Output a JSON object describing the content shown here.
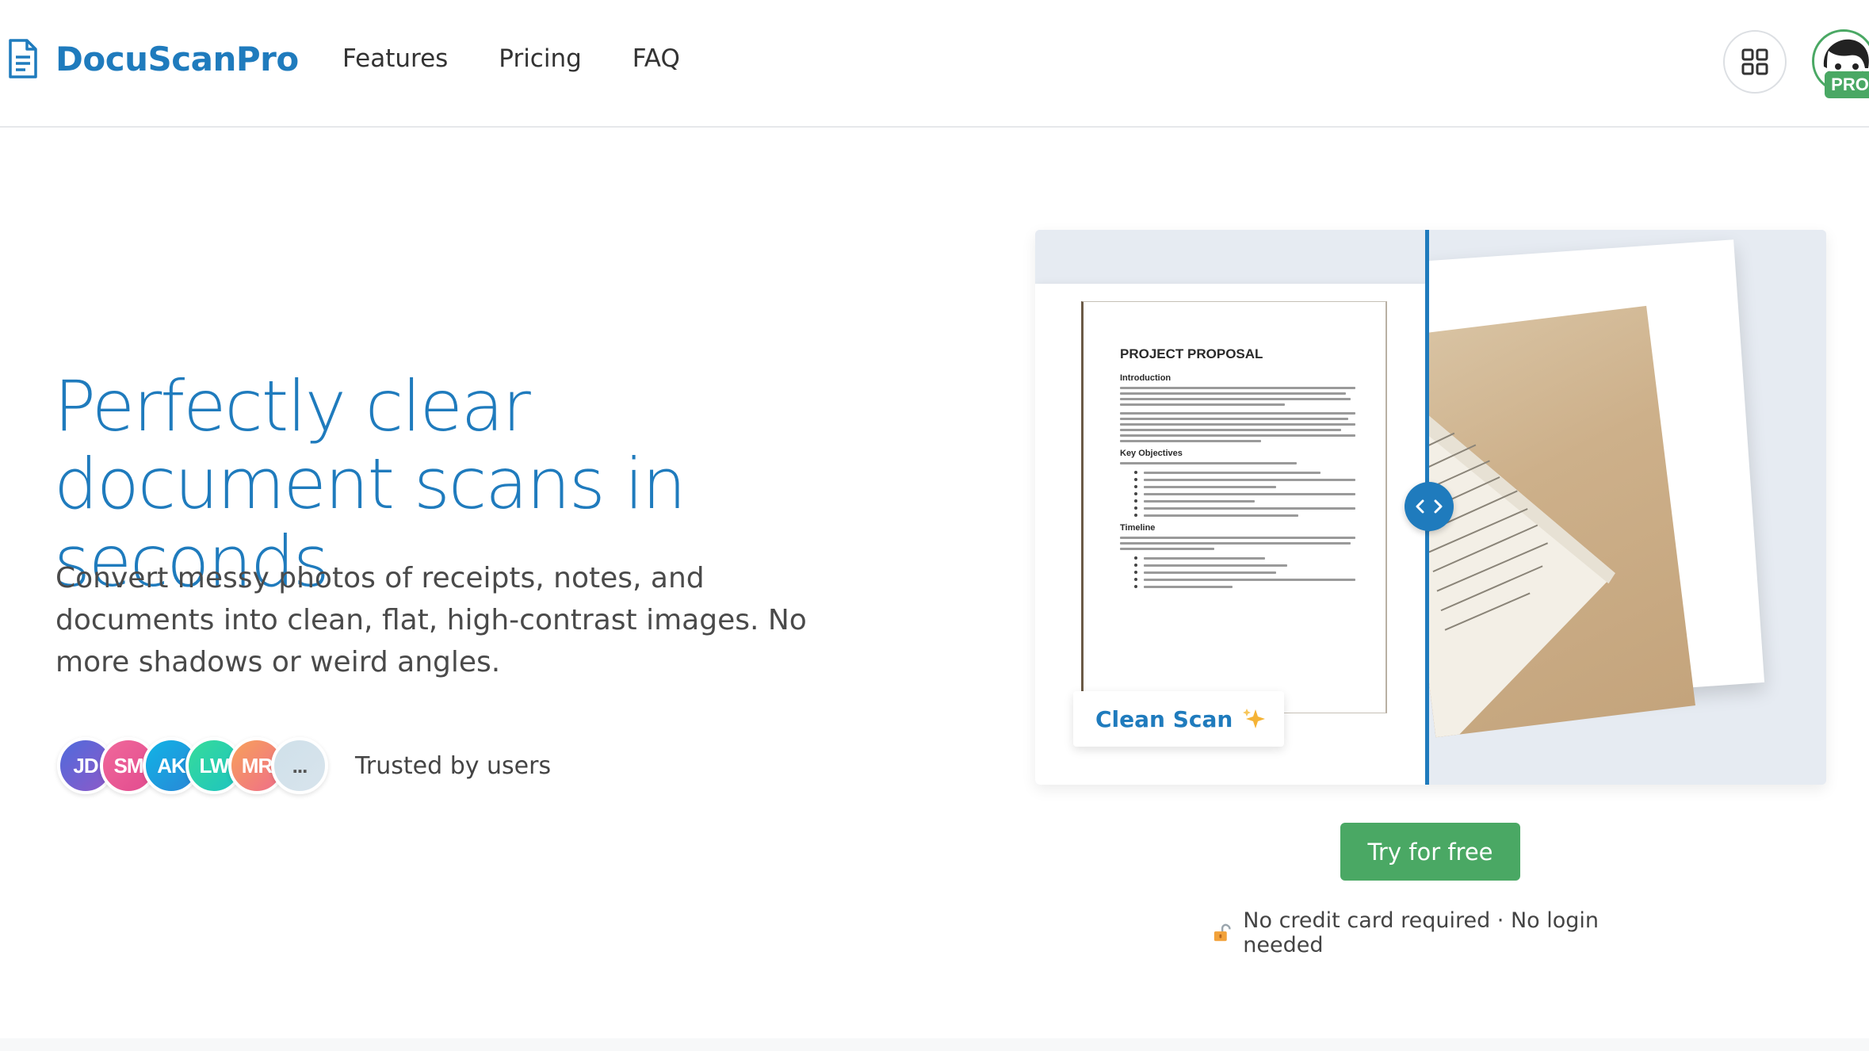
{
  "header": {
    "brand": "DocuScanPro",
    "nav": [
      "Features",
      "Pricing",
      "FAQ"
    ],
    "pro_badge": "PRO"
  },
  "hero": {
    "title": "Perfectly clear document scans in seconds",
    "subtitle": "Convert messy photos of receipts, notes, and documents into clean, flat, high-contrast images. No more shadows or weird angles."
  },
  "trust": {
    "avatars": [
      {
        "initials": "JD",
        "color": "#6a5acd"
      },
      {
        "initials": "SM",
        "color": "#ef5b9c"
      },
      {
        "initials": "AK",
        "color": "#1aa7e0"
      },
      {
        "initials": "LW",
        "color": "#2ed39a"
      },
      {
        "initials": "MR",
        "color": "#f59e6b"
      },
      {
        "initials": "...",
        "color": "#c9dde6"
      }
    ],
    "text": "Trusted by users"
  },
  "compare": {
    "doc_title": "PROJECT PROPOSAL",
    "sections": [
      "Introduction",
      "Key Objectives",
      "Timeline"
    ],
    "clean_label": "Clean Scan",
    "accent": "#1f7bbd"
  },
  "cta": {
    "label": "Try for free",
    "note": "No credit card required · No login needed",
    "color": "#4aa864"
  }
}
